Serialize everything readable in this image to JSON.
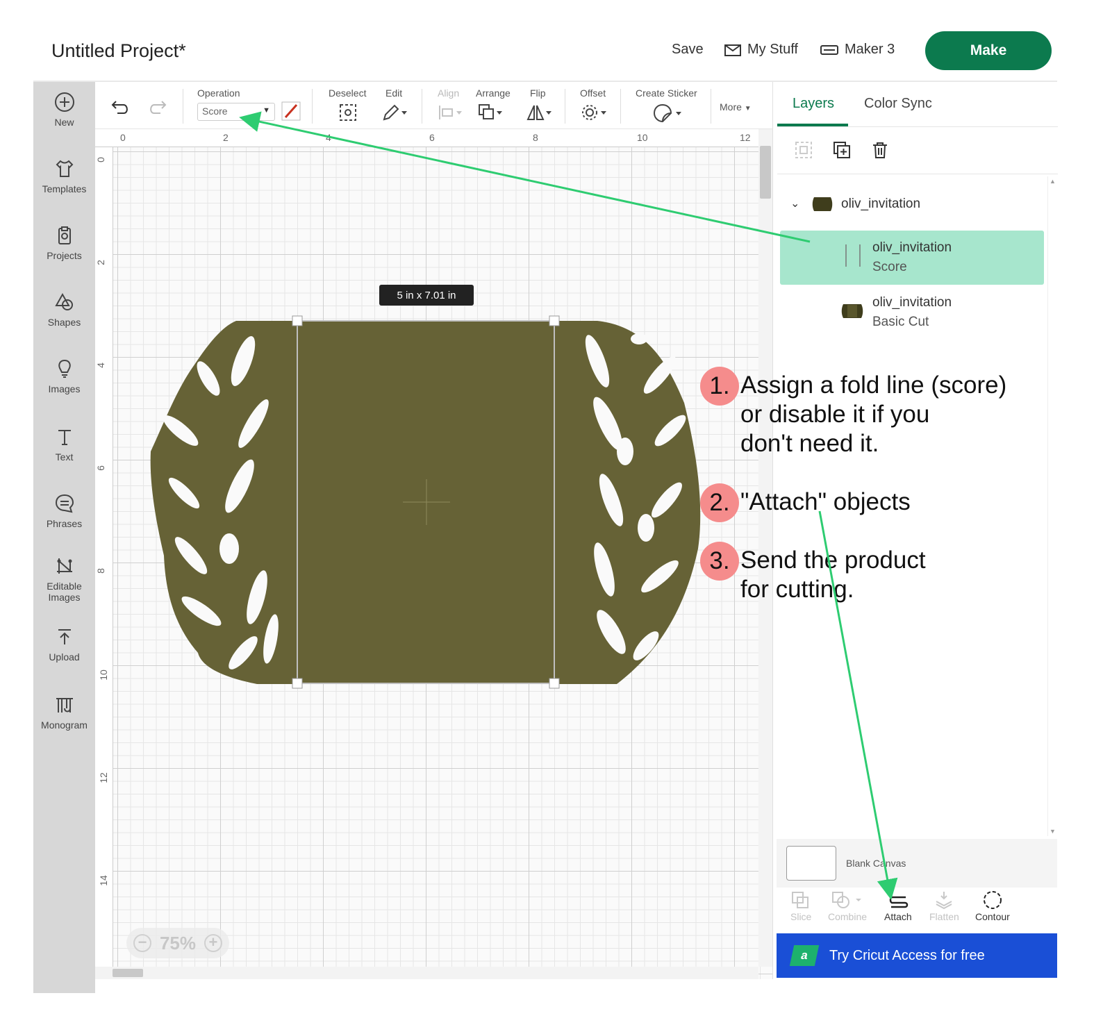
{
  "header": {
    "title": "Untitled Project*",
    "save": "Save",
    "my_stuff": "My Stuff",
    "machine": "Maker 3",
    "make": "Make"
  },
  "sidebar": {
    "items": [
      {
        "label": "New",
        "icon": "plus-circle-icon"
      },
      {
        "label": "Templates",
        "icon": "shirt-icon"
      },
      {
        "label": "Projects",
        "icon": "clipboard-icon"
      },
      {
        "label": "Shapes",
        "icon": "shapes-icon"
      },
      {
        "label": "Images",
        "icon": "bulb-icon"
      },
      {
        "label": "Text",
        "icon": "text-icon"
      },
      {
        "label": "Phrases",
        "icon": "speech-bubble-icon"
      },
      {
        "label": "Editable",
        "label2": "Images",
        "icon": "editable-image-icon"
      },
      {
        "label": "Upload",
        "icon": "upload-icon"
      },
      {
        "label": "Monogram",
        "icon": "monogram-icon"
      }
    ]
  },
  "toolbar": {
    "operation_label": "Operation",
    "operation_value": "Score",
    "deselect": "Deselect",
    "edit": "Edit",
    "align": "Align",
    "arrange": "Arrange",
    "flip": "Flip",
    "offset": "Offset",
    "create_sticker": "Create Sticker",
    "more": "More"
  },
  "canvas": {
    "ruler_top": [
      "0",
      "2",
      "4",
      "6",
      "8",
      "10",
      "12"
    ],
    "ruler_left": [
      "0",
      "2",
      "4",
      "6",
      "8",
      "10",
      "12",
      "14"
    ],
    "dimension_tag": "5  in x 7.01  in",
    "zoom_level": "75%",
    "design_color": "#666236"
  },
  "panel": {
    "tabs": [
      "Layers",
      "Color Sync"
    ],
    "group_name": "oliv_invitation",
    "layers": [
      {
        "name": "oliv_invitation",
        "operation": "Score",
        "selected": true
      },
      {
        "name": "oliv_invitation",
        "operation": "Basic Cut",
        "selected": false
      }
    ],
    "blank_canvas": "Blank Canvas",
    "tools": [
      "Slice",
      "Combine",
      "Attach",
      "Flatten",
      "Contour"
    ],
    "access_logo": "a",
    "access_text": "Try Cricut Access for free"
  },
  "annotations": {
    "steps": [
      {
        "num": "1.",
        "lines": [
          "Assign a fold line (score)",
          "or disable it if you",
          "don't need it."
        ]
      },
      {
        "num": "2.",
        "lines": [
          "\"Attach\" objects"
        ]
      },
      {
        "num": "3.",
        "lines": [
          "Send the product",
          "for cutting."
        ]
      }
    ],
    "arrow_color": "#2ecc71",
    "badge_color": "#f58c8c"
  }
}
